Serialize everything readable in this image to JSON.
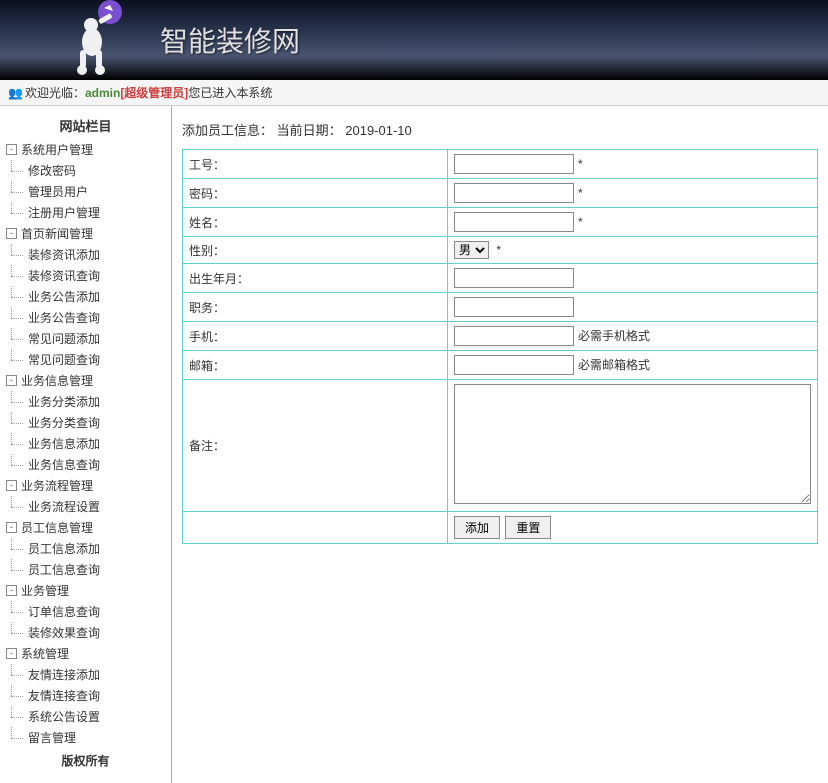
{
  "header": {
    "site_title": "智能装修网"
  },
  "welcome": {
    "prefix": "欢迎光临：",
    "username": "admin",
    "role": "[超级管理员]",
    "suffix": " 您已进入本系统"
  },
  "sidebar": {
    "title": "网站栏目",
    "footer": "版权所有",
    "groups": [
      {
        "label": "系统用户管理",
        "children": [
          "修改密码",
          "管理员用户",
          "注册用户管理"
        ]
      },
      {
        "label": "首页新闻管理",
        "children": [
          "装修资讯添加",
          "装修资讯查询",
          "业务公告添加",
          "业务公告查询",
          "常见问题添加",
          "常见问题查询"
        ]
      },
      {
        "label": "业务信息管理",
        "children": [
          "业务分类添加",
          "业务分类查询",
          "业务信息添加",
          "业务信息查询"
        ]
      },
      {
        "label": "业务流程管理",
        "children": [
          "业务流程设置"
        ]
      },
      {
        "label": "员工信息管理",
        "children": [
          "员工信息添加",
          "员工信息查询"
        ]
      },
      {
        "label": "业务管理",
        "children": [
          "订单信息查询",
          "装修效果查询"
        ]
      },
      {
        "label": "系统管理",
        "children": [
          "友情连接添加",
          "友情连接查询",
          "系统公告设置",
          "留言管理"
        ]
      }
    ]
  },
  "main": {
    "heading_prefix": "添加员工信息： 当前日期：",
    "date": "2019-01-10",
    "fields": {
      "emp_no": "工号：",
      "password": "密码：",
      "name": "姓名：",
      "gender": "性别：",
      "gender_options": [
        "男"
      ],
      "gender_selected": "男",
      "birth": "出生年月：",
      "position": "职务：",
      "phone": "手机：",
      "phone_hint": "必需手机格式",
      "email": "邮箱：",
      "email_hint": "必需邮箱格式",
      "remark": "备注：",
      "required_mark": "*"
    },
    "buttons": {
      "submit": "添加",
      "reset": "重置"
    }
  }
}
